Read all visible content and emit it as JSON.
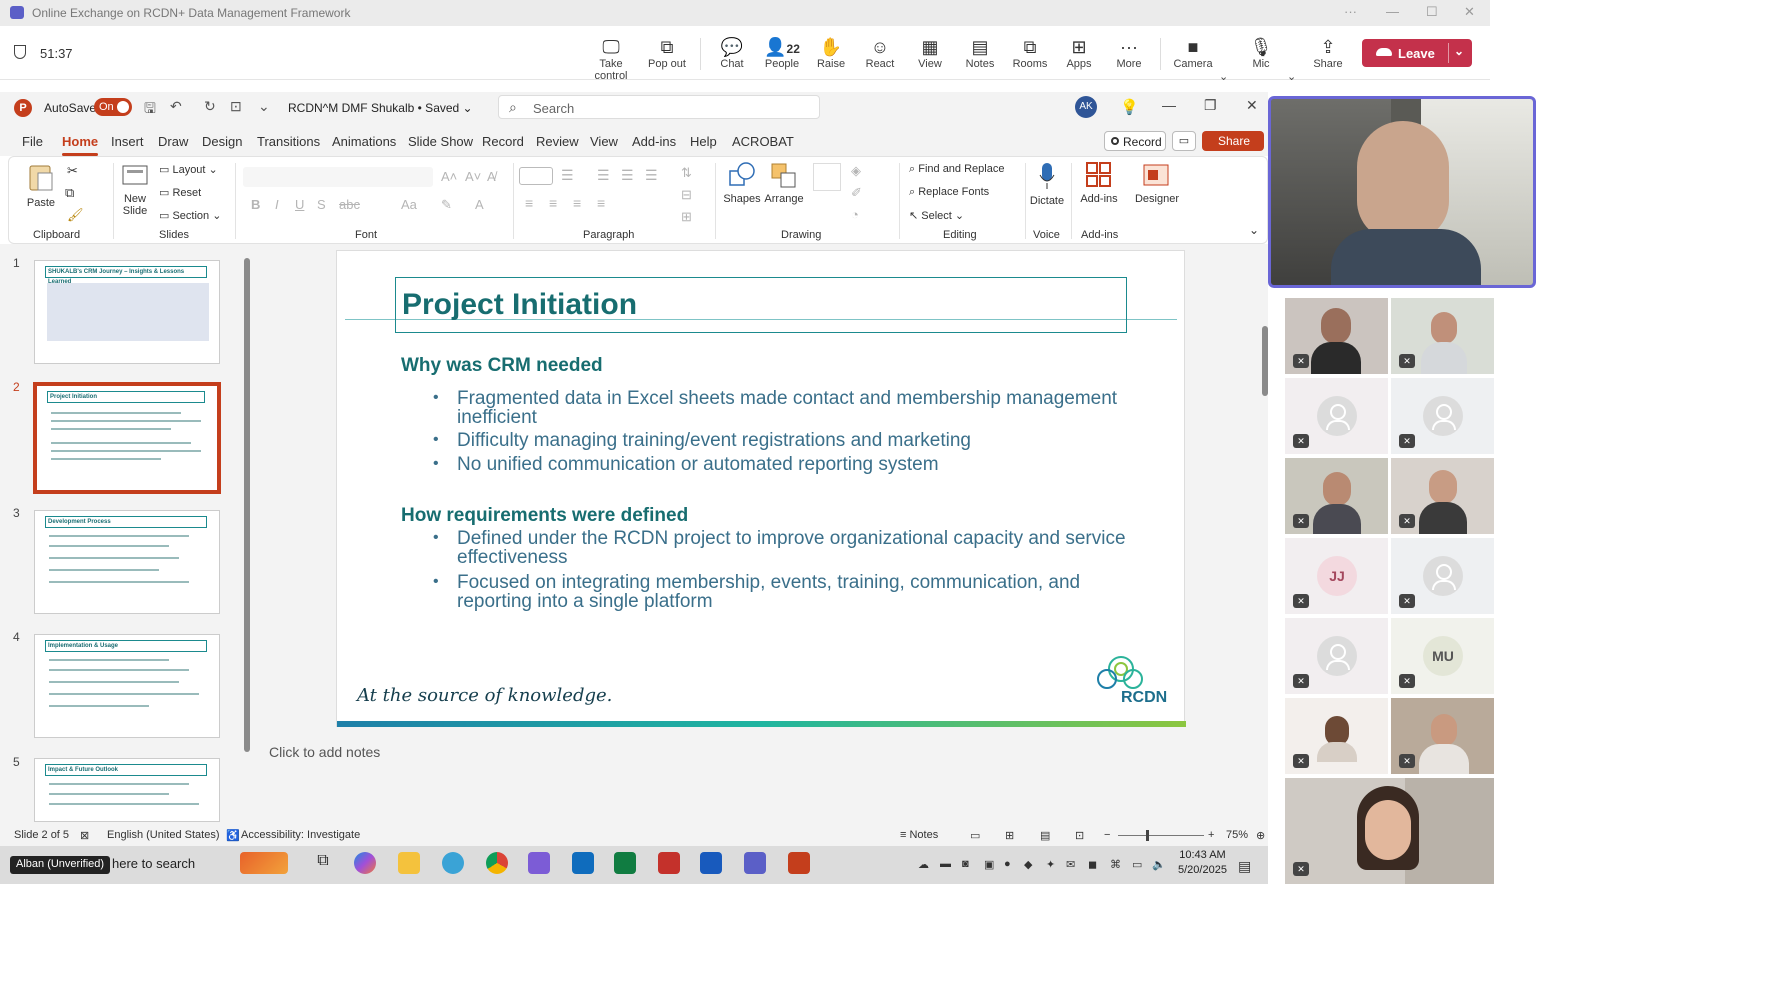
{
  "teams": {
    "window_title": "Online Exchange on RCDN+ Data Management Framework",
    "timer": "51:37",
    "tools": [
      {
        "label": "Take control"
      },
      {
        "label": "Pop out"
      },
      {
        "label": "Chat"
      },
      {
        "label": "People",
        "count": "22"
      },
      {
        "label": "Raise"
      },
      {
        "label": "React"
      },
      {
        "label": "View"
      },
      {
        "label": "Notes"
      },
      {
        "label": "Rooms"
      },
      {
        "label": "Apps"
      },
      {
        "label": "More"
      },
      {
        "label": "Camera"
      },
      {
        "label": "Mic"
      },
      {
        "label": "Share"
      }
    ],
    "leave_label": "Leave"
  },
  "ppt": {
    "autosave_label": "AutoSave",
    "autosave_state": "On",
    "doc_name": "RCDN^M DMF Shukalb • Saved",
    "search_placeholder": "Search",
    "user_initials": "AK",
    "tabs": [
      "File",
      "Home",
      "Insert",
      "Draw",
      "Design",
      "Transitions",
      "Animations",
      "Slide Show",
      "Record",
      "Review",
      "View",
      "Add-ins",
      "Help",
      "ACROBAT"
    ],
    "record_label": "Record",
    "share_label": "Share",
    "ribbon": {
      "paste": "Paste",
      "clipboard": "Clipboard",
      "new_slide": "New",
      "new_slide_2": "Slide",
      "layout": "Layout",
      "reset": "Reset",
      "section": "Section",
      "slides": "Slides",
      "font": "Font",
      "paragraph": "Paragraph",
      "shapes": "Shapes",
      "arrange": "Arrange",
      "drawing": "Drawing",
      "find_replace": "Find and Replace",
      "replace_fonts": "Replace Fonts",
      "select": "Select",
      "editing": "Editing",
      "dictate": "Dictate",
      "voice": "Voice",
      "addins": "Add-ins",
      "addins_group": "Add-ins",
      "designer": "Designer"
    },
    "thumbs": [
      {
        "num": "1",
        "title": "SHUKALB's CRM Journey – Insights & Lessons Learned"
      },
      {
        "num": "2",
        "title": "Project Initiation"
      },
      {
        "num": "3",
        "title": "Development Process"
      },
      {
        "num": "4",
        "title": "Implementation & Usage"
      },
      {
        "num": "5",
        "title": "Impact & Future Outlook"
      }
    ],
    "slide": {
      "title": "Project Initiation",
      "heading1": "Why was CRM needed",
      "bullets1": [
        "Fragmented data in Excel sheets made contact and membership management inefficient",
        "Difficulty managing training/event registrations and marketing",
        "No unified communication or automated reporting system"
      ],
      "heading2": "How requirements were defined",
      "bullets2": [
        "Defined under the RCDN project to improve organizational capacity and service effectiveness",
        "Focused on integrating membership, events, training, communication, and reporting into a single platform"
      ],
      "tagline": "At the source of knowledge.",
      "logo_text": "RCDN"
    },
    "notes_placeholder": "Click to add notes",
    "status": {
      "slide_counter": "Slide 2 of 5",
      "language": "English (United States)",
      "accessibility": "Accessibility: Investigate",
      "notes": "Notes",
      "zoom": "75%"
    }
  },
  "taskbar": {
    "user": "Alban (Unverified)",
    "search_text": "here to search",
    "time": "10:43 AM",
    "date": "5/20/2025"
  },
  "participants": {
    "tiles": [
      {
        "type": "video"
      },
      {
        "type": "video"
      },
      {
        "type": "avatar"
      },
      {
        "type": "avatar"
      },
      {
        "type": "video"
      },
      {
        "type": "video"
      },
      {
        "type": "initials",
        "initials": "JJ"
      },
      {
        "type": "avatar"
      },
      {
        "type": "avatar"
      },
      {
        "type": "initials",
        "initials": "MU"
      },
      {
        "type": "video"
      },
      {
        "type": "video"
      }
    ]
  },
  "colors": {
    "accent": "#c43e1c",
    "teal": "#176d70",
    "leave": "#c4314b"
  }
}
